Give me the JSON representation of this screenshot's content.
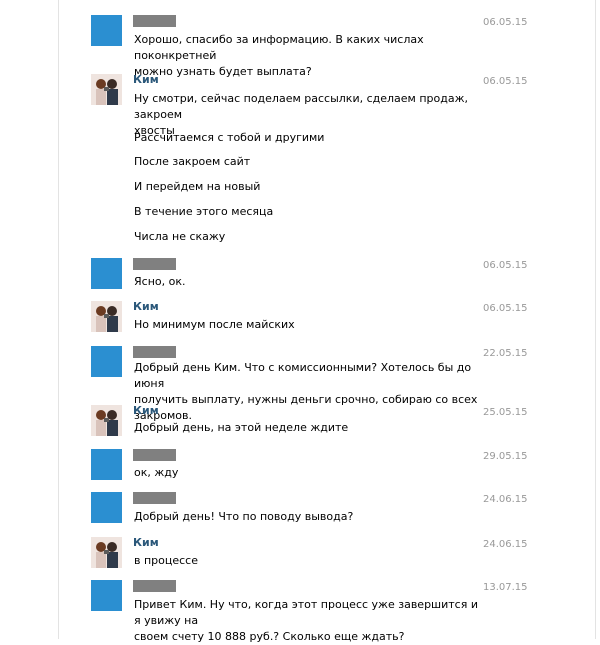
{
  "messages": [
    {
      "redacted": true,
      "avatar": "blank",
      "date": "06.05.15",
      "lines": [
        "Хорошо, спасибо за информацию. В каких числах поконкретней",
        "можно узнать будет выплата?"
      ]
    },
    {
      "redacted": false,
      "name": "Ким",
      "avatar": "photo",
      "date": "06.05.15",
      "lines": [
        "Ну смотри, сейчас поделаем рассылки, сделаем продаж, закроем",
        "хвосты"
      ],
      "extra": [
        "Рассчитаемся с тобой и другими",
        "После закроем сайт",
        "И перейдем на новый",
        "В течение этого месяца",
        "Числа не скажу"
      ]
    },
    {
      "redacted": true,
      "avatar": "blank",
      "date": "06.05.15",
      "lines": [
        "Ясно, ок."
      ]
    },
    {
      "redacted": false,
      "name": "Ким",
      "avatar": "photo",
      "date": "06.05.15",
      "lines": [
        "Но минимум после майских"
      ]
    },
    {
      "redacted": true,
      "avatar": "blank",
      "date": "22.05.15",
      "lines": [
        "Добрый день Ким. Что с комиссионными? Хотелось бы до июня",
        "получить выплату, нужны деньги срочно, собираю со всех закромов."
      ]
    },
    {
      "redacted": false,
      "name": "Ким",
      "avatar": "photo",
      "date": "25.05.15",
      "lines": [
        "Добрый день, на этой неделе ждите"
      ]
    },
    {
      "redacted": true,
      "avatar": "blank",
      "date": "29.05.15",
      "lines": [
        "ок, жду"
      ]
    },
    {
      "redacted": true,
      "avatar": "blank",
      "date": "24.06.15",
      "lines": [
        "Добрый день! Что по поводу вывода?"
      ]
    },
    {
      "redacted": false,
      "name": "Ким",
      "avatar": "photo",
      "date": "24.06.15",
      "lines": [
        "в процессе"
      ]
    },
    {
      "redacted": true,
      "avatar": "blank",
      "date": "13.07.15",
      "lines": [
        "Привет Ким. Ну что, когда этот процесс уже завершится и я увижу на",
        "своем счету 10 888 руб.? Сколько еще ждать?"
      ]
    }
  ]
}
